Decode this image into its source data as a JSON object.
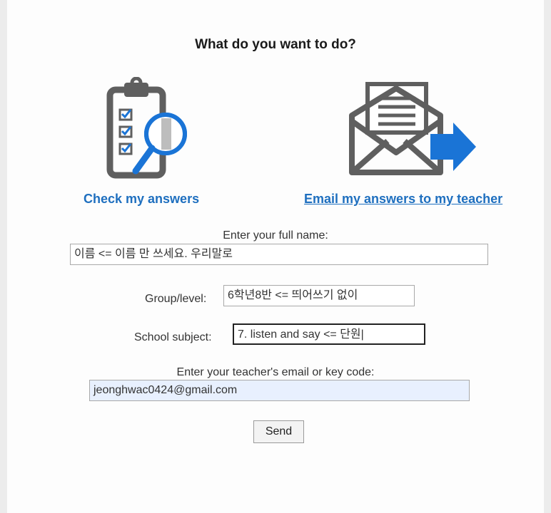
{
  "page": {
    "title": "What do you want to do?"
  },
  "actions": {
    "check_label": "Check my answers",
    "email_label": "Email my answers to my teacher",
    "check_icon": "clipboard-magnifier-icon",
    "email_icon": "envelope-send-icon"
  },
  "form": {
    "name_label": "Enter your full name:",
    "name_value": "이름  <= 이름 만 쓰세요. 우리말로",
    "group_label": "Group/level:",
    "group_value": "6학년8반  <=  띄어쓰기 없이",
    "subject_label": "School subject:",
    "subject_value": "7. listen and say  <= 단원|",
    "email_label": "Enter your teacher's email or key code:",
    "email_value": "jeonghwac0424@gmail.com",
    "send_label": "Send"
  },
  "colors": {
    "link": "#1e6fbf",
    "icon_gray": "#5f5f5f",
    "icon_blue": "#1a74d6",
    "autofill_bg": "#e8f0fe"
  }
}
